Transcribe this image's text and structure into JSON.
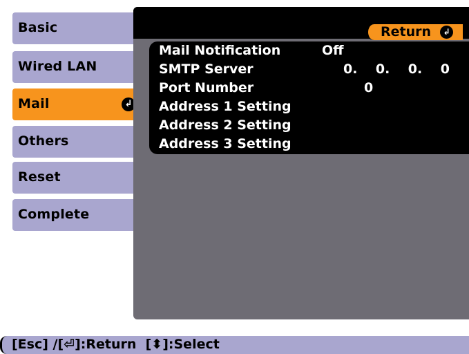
{
  "menu": {
    "items": [
      {
        "label": "Basic"
      },
      {
        "label": "Wired LAN"
      },
      {
        "label": "Mail"
      },
      {
        "label": "Others"
      },
      {
        "label": "Reset"
      },
      {
        "label": "Complete"
      }
    ],
    "active_index": 2
  },
  "panel": {
    "return_label": "Return",
    "settings": [
      {
        "label": "Mail Notification",
        "value": "Off"
      },
      {
        "label": "SMTP Server",
        "value": "0.    0.    0.    0"
      },
      {
        "label": "Port Number",
        "value": "0"
      },
      {
        "label": "Address 1 Setting",
        "value": ""
      },
      {
        "label": "Address 2 Setting",
        "value": ""
      },
      {
        "label": "Address 3 Setting",
        "value": ""
      }
    ]
  },
  "helpbar": {
    "text": "[Esc] /[⏎]:Return  [⬍]:Select"
  },
  "colors": {
    "tab": "#a9a6cf",
    "active": "#f7941d",
    "panel": "#6e6c74",
    "list": "#000000"
  }
}
